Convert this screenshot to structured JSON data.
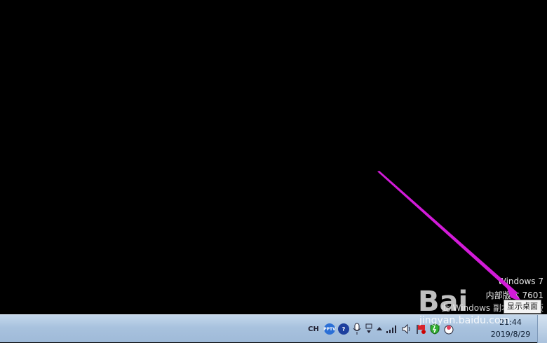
{
  "watermark": {
    "line1": "Windows 7",
    "line2": "内部版本 7601",
    "line3": "此 Windows 副本不是正版"
  },
  "tooltip": {
    "text": "显示桌面"
  },
  "tray": {
    "language": "CH",
    "pptv_label": "PPTV",
    "help_label": "?"
  },
  "clock": {
    "time": "21:44",
    "date": "2019/8/29"
  },
  "overlay": {
    "site": "jingyan.baidu.com",
    "logo": "Bai"
  },
  "colors": {
    "arrow": "#d21bd8",
    "taskbar": "#a8c2de"
  }
}
